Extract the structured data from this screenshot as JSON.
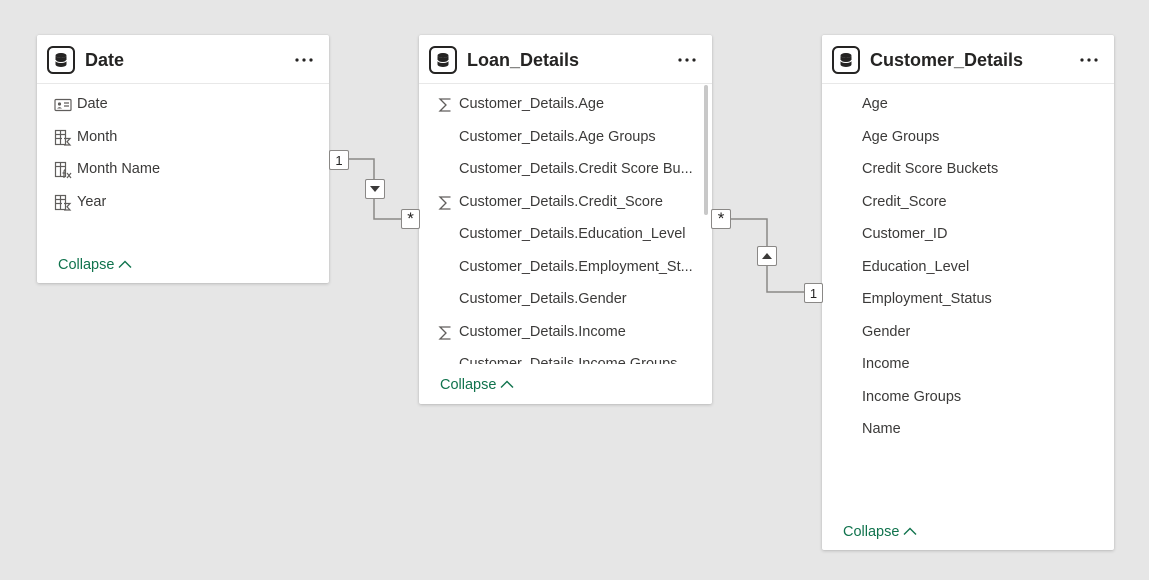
{
  "tables": [
    {
      "title": "Date",
      "fields": [
        {
          "label": "Date",
          "icon": "id-card-icon"
        },
        {
          "label": "Month",
          "icon": "calc-column-icon"
        },
        {
          "label": "Month Name",
          "icon": "calc-column-fx-icon"
        },
        {
          "label": "Year",
          "icon": "calc-column-icon"
        }
      ],
      "collapse_label": "Collapse"
    },
    {
      "title": "Loan_Details",
      "fields": [
        {
          "label": "Customer_Details.Age",
          "icon": "sigma-icon"
        },
        {
          "label": "Customer_Details.Age Groups",
          "icon": ""
        },
        {
          "label": "Customer_Details.Credit Score Bu...",
          "icon": ""
        },
        {
          "label": "Customer_Details.Credit_Score",
          "icon": "sigma-icon"
        },
        {
          "label": "Customer_Details.Education_Level",
          "icon": ""
        },
        {
          "label": "Customer_Details.Employment_St...",
          "icon": ""
        },
        {
          "label": "Customer_Details.Gender",
          "icon": ""
        },
        {
          "label": "Customer_Details.Income",
          "icon": "sigma-icon"
        },
        {
          "label": "Customer_Details.Income Groups",
          "icon": ""
        }
      ],
      "collapse_label": "Collapse"
    },
    {
      "title": "Customer_Details",
      "fields": [
        {
          "label": "Age",
          "icon": ""
        },
        {
          "label": "Age Groups",
          "icon": ""
        },
        {
          "label": "Credit Score Buckets",
          "icon": ""
        },
        {
          "label": "Credit_Score",
          "icon": ""
        },
        {
          "label": "Customer_ID",
          "icon": ""
        },
        {
          "label": "Education_Level",
          "icon": ""
        },
        {
          "label": "Employment_Status",
          "icon": ""
        },
        {
          "label": "Gender",
          "icon": ""
        },
        {
          "label": "Income",
          "icon": ""
        },
        {
          "label": "Income Groups",
          "icon": ""
        },
        {
          "label": "Name",
          "icon": ""
        }
      ],
      "collapse_label": "Collapse"
    }
  ],
  "relationships": [
    {
      "from_cardinality": "1",
      "to_cardinality": "*",
      "filter_direction": "down"
    },
    {
      "from_cardinality": "*",
      "to_cardinality": "1",
      "filter_direction": "up"
    }
  ],
  "colors": {
    "canvas": "#e6e6e6",
    "accent": "#10734d",
    "line": "#8a8886"
  }
}
